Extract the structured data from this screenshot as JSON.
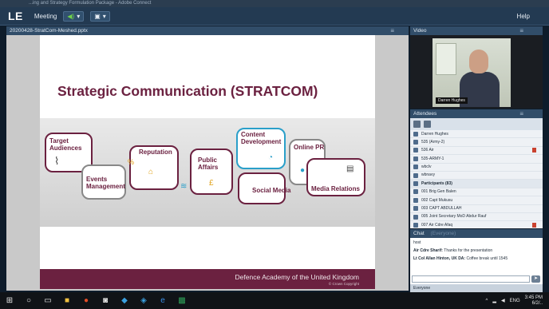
{
  "window": {
    "title": "...ing and Strategy Formulation Package - Adobe Connect"
  },
  "menubar": {
    "logo": "LE",
    "meeting": "Meeting",
    "help": "Help",
    "mic_control": "◀)",
    "cam_control": "▣"
  },
  "share_pod": {
    "filename": "20200428-StratCom-Meshed.pptx"
  },
  "slide": {
    "title": "Strategic Communication (STRATCOM)",
    "topics": [
      "Target Audiences",
      "Events Management",
      "Reputation",
      "Public Affairs",
      "Content Development",
      "Social Media",
      "Online PR",
      "Media Relations"
    ],
    "footer_title": "Defence Academy of the United Kingdom",
    "footer_copyright": "© Crown Copyright"
  },
  "video_pod": {
    "title": "Video",
    "presenter_tag": "Darren Hughes"
  },
  "attendees": {
    "title": "Attendees",
    "rows": [
      {
        "name": "Darren Hughes",
        "group": false,
        "flag": false
      },
      {
        "name": "535 (Army-2)",
        "group": false,
        "flag": false
      },
      {
        "name": "536 Air",
        "group": false,
        "flag": true
      },
      {
        "name": "535-ARMY-1",
        "group": false,
        "flag": false
      },
      {
        "name": "wbclv",
        "group": false,
        "flag": false
      },
      {
        "name": "wbnavy",
        "group": false,
        "flag": false
      },
      {
        "name": "Participants (83)",
        "group": true,
        "flag": false
      },
      {
        "name": "001 Brig Gen Balen",
        "group": false,
        "flag": false
      },
      {
        "name": "002 Capt Mukusu",
        "group": false,
        "flag": false
      },
      {
        "name": "003 CAPT ABDULLAH",
        "group": false,
        "flag": false
      },
      {
        "name": "005 Joint Secretary MoD Abdur Rauf",
        "group": false,
        "flag": false
      },
      {
        "name": "007 Air Cdre Afaq",
        "group": false,
        "flag": true
      },
      {
        "name": "009 Brig Gen Amin",
        "group": false,
        "flag": false
      }
    ]
  },
  "chat": {
    "title": "Chat",
    "title_extra": "(Everyone)",
    "lines": [
      {
        "sender": "",
        "text": "host"
      },
      {
        "sender": "Air Cdre Sharif:",
        "text": "Thanks for the presentation"
      },
      {
        "sender": "Lt Col Allan Hinton, UK DA:",
        "text": "Coffee break until 1545"
      }
    ],
    "audience": "Everyone"
  },
  "taskbar": {
    "time": "3:45 PM",
    "date": "6/2/..",
    "lang": "ENG"
  },
  "colors": {
    "accent": "#6b2140",
    "pod_header": "#314d69",
    "menubar": "#233a52"
  }
}
